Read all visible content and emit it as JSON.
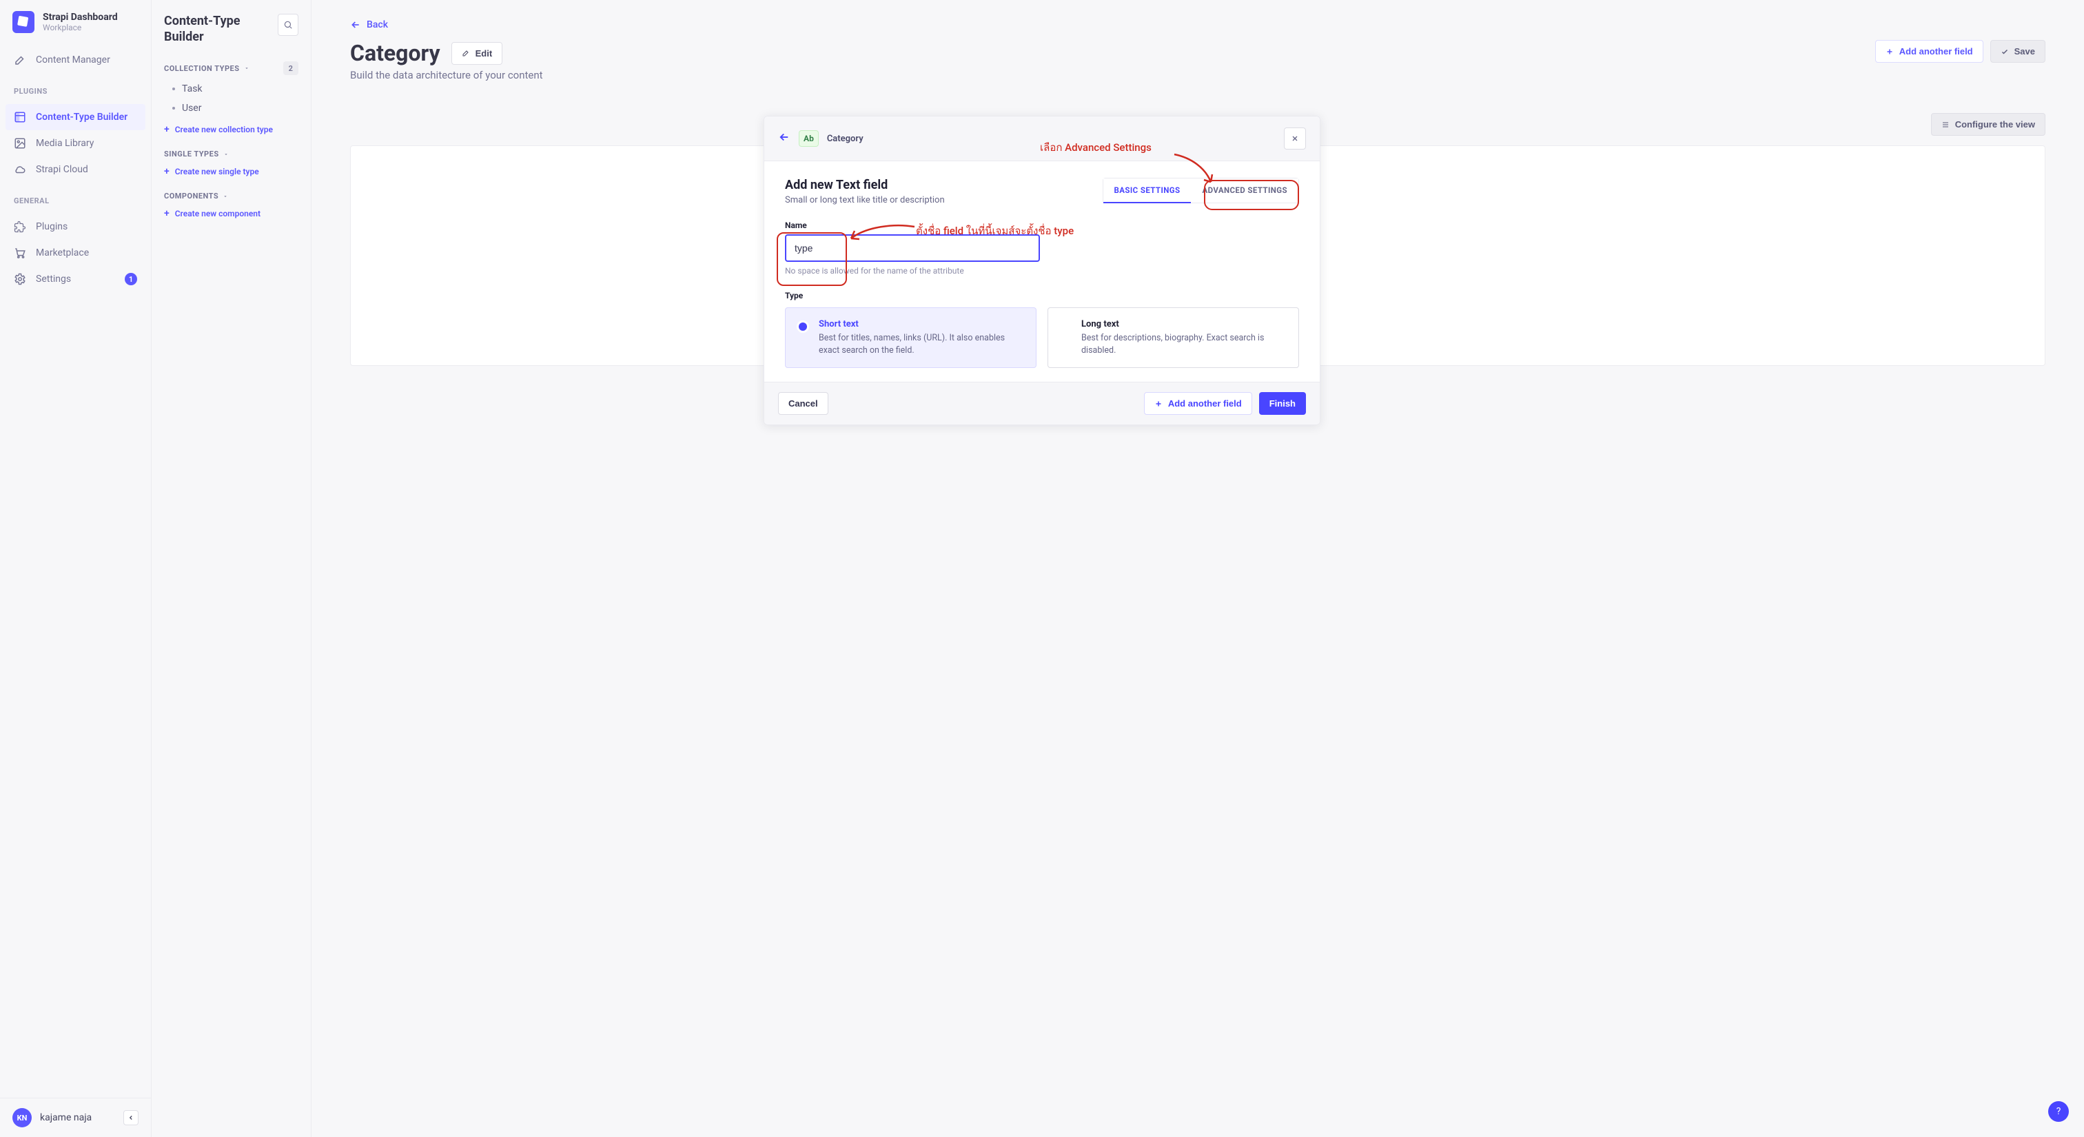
{
  "brand": {
    "title": "Strapi Dashboard",
    "subtitle": "Workplace"
  },
  "nav": {
    "items": [
      {
        "label": "Content Manager",
        "icon": "pencil"
      }
    ],
    "sections": [
      {
        "label": "PLUGINS",
        "items": [
          {
            "label": "Content-Type Builder",
            "icon": "layout",
            "active": true
          },
          {
            "label": "Media Library",
            "icon": "image"
          },
          {
            "label": "Strapi Cloud",
            "icon": "cloud"
          }
        ]
      },
      {
        "label": "GENERAL",
        "items": [
          {
            "label": "Plugins",
            "icon": "puzzle"
          },
          {
            "label": "Marketplace",
            "icon": "cart"
          },
          {
            "label": "Settings",
            "icon": "gear",
            "badge": "1"
          }
        ]
      }
    ],
    "user": {
      "initials": "KN",
      "name": "kajame naja"
    }
  },
  "subnav": {
    "title": "Content-Type Builder",
    "sections": [
      {
        "label": "COLLECTION TYPES",
        "count": "2",
        "items": [
          {
            "label": "Task"
          },
          {
            "label": "User"
          }
        ],
        "create": "Create new collection type"
      },
      {
        "label": "SINGLE TYPES",
        "items": [],
        "create": "Create new single type"
      },
      {
        "label": "COMPONENTS",
        "items": [],
        "create": "Create new component"
      }
    ]
  },
  "page": {
    "back": "Back",
    "title": "Category",
    "subtitle": "Build the data architecture of your content",
    "edit": "Edit",
    "add_field": "Add another field",
    "save": "Save",
    "configure": "Configure the view"
  },
  "modal": {
    "type_pill": "Ab",
    "breadcrumb": "Category",
    "title": "Add new Text field",
    "description": "Small or long text like title or description",
    "tabs": {
      "basic": "Basic settings",
      "advanced": "Advanced settings"
    },
    "field_name_label": "Name",
    "field_name_value": "type",
    "field_name_hint": "No space is allowed for the name of the attribute",
    "type_label": "Type",
    "options": {
      "short": {
        "title": "Short text",
        "desc": "Best for titles, names, links (URL). It also enables exact search on the field."
      },
      "long": {
        "title": "Long text",
        "desc": "Best for descriptions, biography. Exact search is disabled."
      }
    },
    "cancel": "Cancel",
    "add_another": "Add another field",
    "finish": "Finish"
  },
  "annotations": {
    "advanced": "เลือก Advanced Settings",
    "name": "ตั้งชื่อ field ในที่นี้เจมส์จะตั้งชื่อ type"
  },
  "help": "?"
}
